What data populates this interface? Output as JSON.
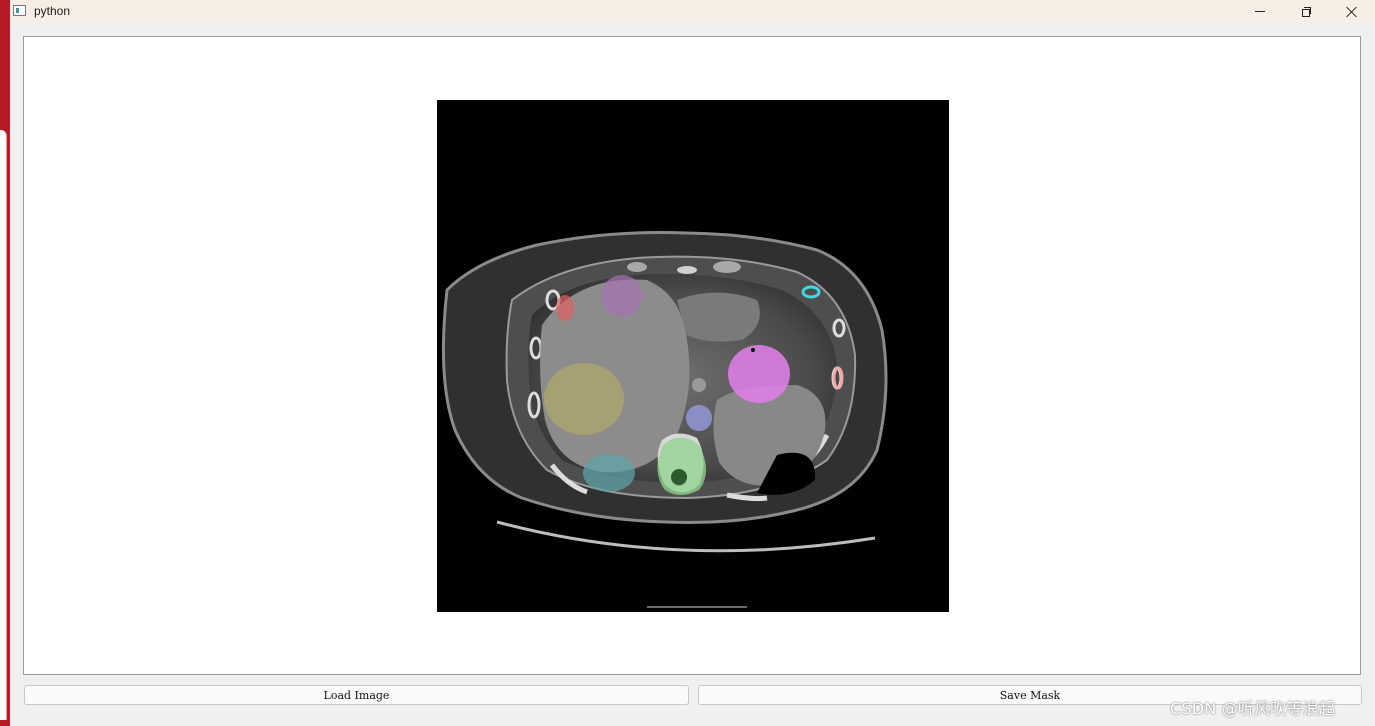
{
  "window": {
    "title": "python",
    "controls": [
      "minimize-icon",
      "restore-icon",
      "close-icon"
    ]
  },
  "viewer": {
    "image": "axial abdominal CT slice with segmentation mask overlay"
  },
  "buttons": {
    "load_label": "Load Image",
    "save_label": "Save Mask"
  },
  "watermark": "CSDN @听风吹等浪起",
  "colors": {
    "title_bar": "#f7efe6",
    "red_edge": "#b71c26",
    "mask_purple": "#a574b0",
    "mask_yellow": "#b0a96a",
    "mask_teal": "#5fa4a8",
    "mask_green": "#8fd38f",
    "mask_blue": "#8b8fd6",
    "mask_magenta": "#e07ee8",
    "mask_red": "#e06060",
    "mask_cyan": "#43d6dd"
  }
}
